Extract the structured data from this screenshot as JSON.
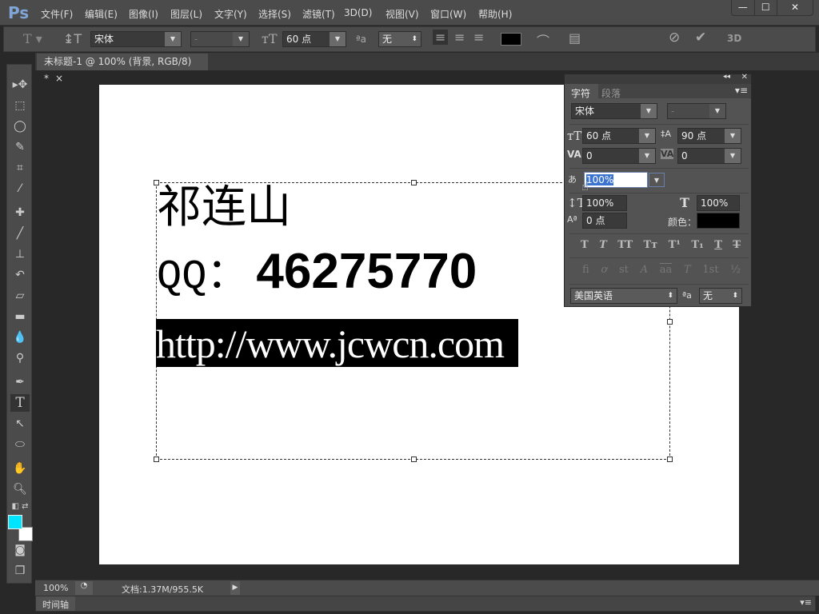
{
  "app": {
    "logo": "Ps",
    "window_buttons": [
      "—",
      "☐",
      "✕"
    ]
  },
  "menu": [
    "文件(F)",
    "编辑(E)",
    "图像(I)",
    "图层(L)",
    "文字(Y)",
    "选择(S)",
    "滤镜(T)",
    "3D(D)",
    "视图(V)",
    "窗口(W)",
    "帮助(H)"
  ],
  "options": {
    "font_family": "宋体",
    "font_style": "-",
    "font_size": "60 点",
    "antialias": "无",
    "text_color": "#000000",
    "label_3d": "3D"
  },
  "document_tab": {
    "title": "未标题-1 @ 100% (背景, RGB/8) *",
    "close": "×"
  },
  "tools": {
    "foreground": "#00e5ff",
    "background": "#ffffff"
  },
  "canvas": {
    "line1": "祁连山",
    "line2_prefix": "QQ：",
    "line2_number": "46275770",
    "line3": "http://www.jcwcn.com"
  },
  "panel": {
    "tabs": [
      "字符",
      "段落"
    ],
    "font_family": "宋体",
    "font_style": "-",
    "font_size": "60 点",
    "leading": "90 点",
    "kerning": "0",
    "tracking": "0",
    "scale_value": "100%",
    "vertical_scale": "100%",
    "horizontal_scale": "100%",
    "baseline_shift": "0 点",
    "color_label": "颜色：",
    "color": "#000000",
    "style_buttons": [
      "T",
      "T",
      "TT",
      "Tт",
      "T¹",
      "T₁",
      "T",
      "T"
    ],
    "opentype_buttons": [
      "fi",
      "ơ",
      "st",
      "A",
      "aa",
      "T",
      "1st",
      "½"
    ],
    "language": "美国英语",
    "antialias_label": "ªa",
    "antialias": "无"
  },
  "status": {
    "zoom": "100%",
    "doc_info": "文档:1.37M/955.5K"
  },
  "timeline": {
    "label": "时间轴"
  }
}
